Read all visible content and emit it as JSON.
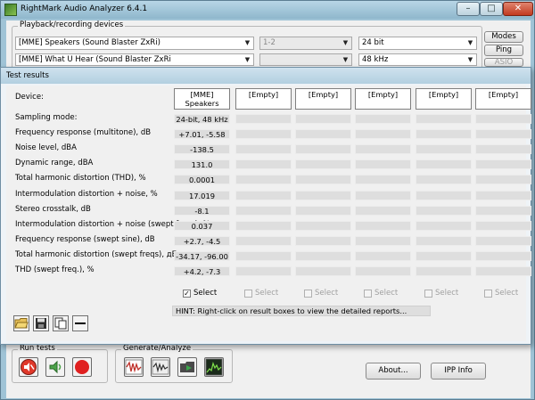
{
  "app": {
    "title": "RightMark Audio Analyzer 6.4.1"
  },
  "window_controls": {
    "minimize": "–",
    "maximize": "□",
    "close": "✕"
  },
  "playback": {
    "group_label": "Playback/recording devices",
    "playback_device": "[MME] Speakers (Sound Blaster ZxRi)",
    "channels": "1-2",
    "bit_depth": "24 bit",
    "recording_device": "[MME] What U Hear (Sound Blaster ZxRi",
    "rec_channels": "",
    "sample_rate": "48 kHz",
    "buttons": {
      "modes": "Modes",
      "ping": "Ping",
      "asio": "ASIO"
    }
  },
  "results": {
    "title": "Test results",
    "device_label": "Device:",
    "devices": [
      "[MME] Speakers (Sound Blaster",
      "[Empty]",
      "[Empty]",
      "[Empty]",
      "[Empty]",
      "[Empty]"
    ],
    "rows": [
      {
        "label": "Sampling mode:",
        "values": [
          "24-bit, 48 kHz",
          "",
          "",
          "",
          "",
          ""
        ]
      },
      {
        "label": "Frequency response (multitone), dB",
        "values": [
          "+7.01, -5.58",
          "",
          "",
          "",
          "",
          ""
        ]
      },
      {
        "label": "Noise level, dBA",
        "values": [
          "-138.5",
          "",
          "",
          "",
          "",
          ""
        ]
      },
      {
        "label": "Dynamic range, dBA",
        "values": [
          "131.0",
          "",
          "",
          "",
          "",
          ""
        ]
      },
      {
        "label": "Total harmonic distortion (THD), %",
        "values": [
          "0.0001",
          "",
          "",
          "",
          "",
          ""
        ]
      },
      {
        "label": "Intermodulation distortion + noise, %",
        "values": [
          "17.019",
          "",
          "",
          "",
          "",
          ""
        ]
      },
      {
        "label": "Stereo crosstalk, dB",
        "values": [
          "-8.1",
          "",
          "",
          "",
          "",
          ""
        ]
      },
      {
        "label": "Intermodulation distortion + noise (swept freqs), %",
        "values": [
          "0.037",
          "",
          "",
          "",
          "",
          ""
        ]
      },
      {
        "label": "Frequency response (swept sine), dB",
        "values": [
          "+2.7, -4.5",
          "",
          "",
          "",
          "",
          ""
        ]
      },
      {
        "label": "Total harmonic distortion (swept freqs), дБ",
        "values": [
          "-34.17, -96.00",
          "",
          "",
          "",
          "",
          ""
        ]
      },
      {
        "label": "THD (swept freq.), %",
        "values": [
          "+4.2, -7.3",
          "",
          "",
          "",
          "",
          ""
        ]
      }
    ],
    "select_label": "Select",
    "select_checked": [
      true,
      false,
      false,
      false,
      false,
      false
    ],
    "select_mark": "✓",
    "hint": "HINT: Right-click on result boxes to view the detailed reports...",
    "tools": [
      "open-folder-icon",
      "save-icon",
      "copy-icon",
      "minus-icon"
    ]
  },
  "run_tests": {
    "label": "Run tests",
    "icons": [
      "speaker-mute-icon",
      "speaker-icon",
      "record-stop-icon"
    ]
  },
  "generate": {
    "label": "Generate/Analyze",
    "icons": [
      "waveform-icon",
      "analyze-waveform-icon",
      "folder-play-icon",
      "spectrum-icon"
    ]
  },
  "footer": {
    "about": "About...",
    "ipp_info": "IPP Info"
  },
  "colors": {
    "accent_record": "#e02020",
    "window_frame": "#9fc3d6"
  }
}
